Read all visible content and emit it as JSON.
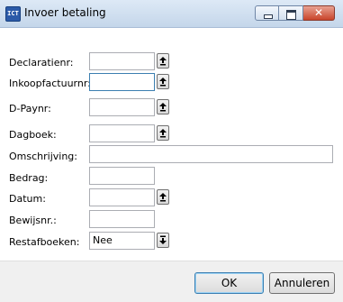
{
  "window": {
    "title": "Invoer betaling",
    "app_icon_text": "ICT"
  },
  "labels": {
    "declaratienr": "Declaratienr:",
    "inkoopfactuurnr": "Inkoopfactuurnr:",
    "dpaynr": "D-Paynr:",
    "dagboek": "Dagboek:",
    "omschrijving": "Omschrijving:",
    "bedrag": "Bedrag:",
    "datum": "Datum:",
    "bewijsnr": "Bewijsnr.:",
    "restafboeken": "Restafboeken:"
  },
  "fields": {
    "declaratienr": "",
    "inkoopfactuurnr": "",
    "dpaynr": "",
    "dagboek": "",
    "omschrijving": "",
    "bedrag": "",
    "datum": "",
    "bewijsnr": "",
    "restafboeken": "Nee"
  },
  "buttons": {
    "ok": "OK",
    "cancel": "Annuleren"
  },
  "icons": {
    "picker": "up-arrow-bar-icon",
    "dropdown": "down-arrow-bar-icon"
  }
}
